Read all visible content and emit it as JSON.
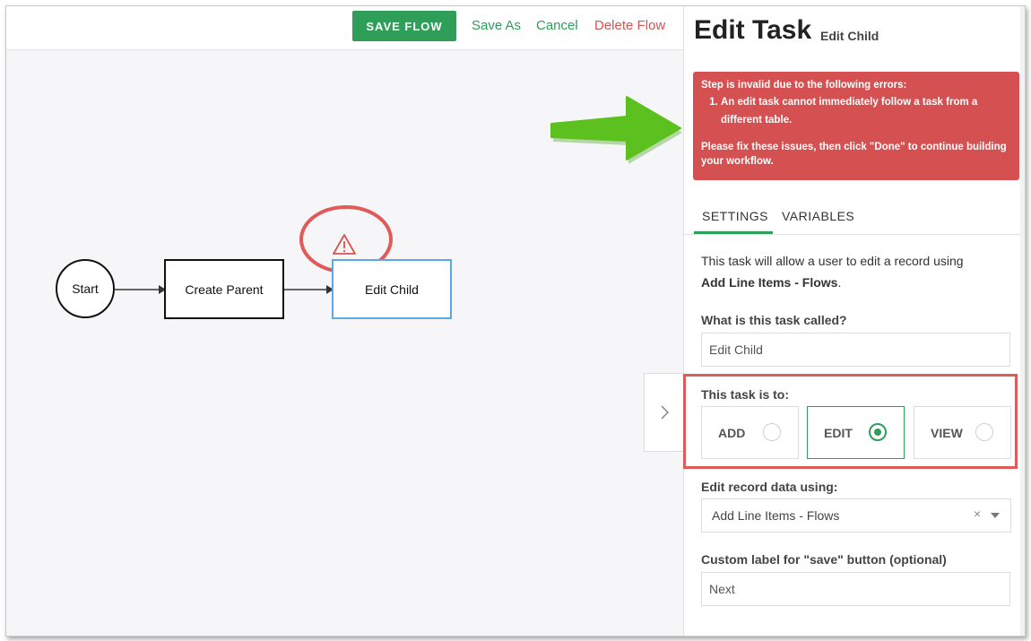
{
  "toolbar": {
    "save_flow": "SAVE FLOW",
    "save_as": "Save As",
    "cancel": "Cancel",
    "delete_flow": "Delete Flow"
  },
  "flow": {
    "nodes": {
      "start": "Start",
      "create_parent": "Create Parent",
      "edit_child": "Edit Child"
    },
    "warning_icon": "warning-triangle-icon"
  },
  "panel": {
    "title": "Edit Task",
    "subtitle": "Edit Child",
    "error": {
      "heading": "Step is invalid due to the following errors:",
      "items": [
        "An edit task cannot immediately follow a task from a different table."
      ],
      "footer": "Please fix these issues, then click \"Done\" to continue building your workflow."
    },
    "tabs": [
      "SETTINGS",
      "VARIABLES"
    ],
    "description_prefix": "This task will allow a user to edit a record using",
    "description_bold": "Add Line Items - Flows",
    "description_suffix": ".",
    "task_name_label": "What is this task called?",
    "task_name_value": "Edit Child",
    "task_type_label": "This task is to:",
    "task_type_options": [
      {
        "label": "ADD",
        "selected": false
      },
      {
        "label": "EDIT",
        "selected": true
      },
      {
        "label": "VIEW",
        "selected": false
      }
    ],
    "record_label": "Edit record data using:",
    "record_value": "Add Line Items - Flows",
    "record_clear": "×",
    "save_label_label": "Custom label for \"save\" button (optional)",
    "save_label_value": "Next"
  },
  "colors": {
    "accent_green": "#2e9e58",
    "danger_red": "#d9534f",
    "error_bg": "#d55050",
    "annotation_red": "#e05a5a",
    "annotation_arrow": "#5cc11e",
    "selected_node_border": "#5aa9e6"
  }
}
